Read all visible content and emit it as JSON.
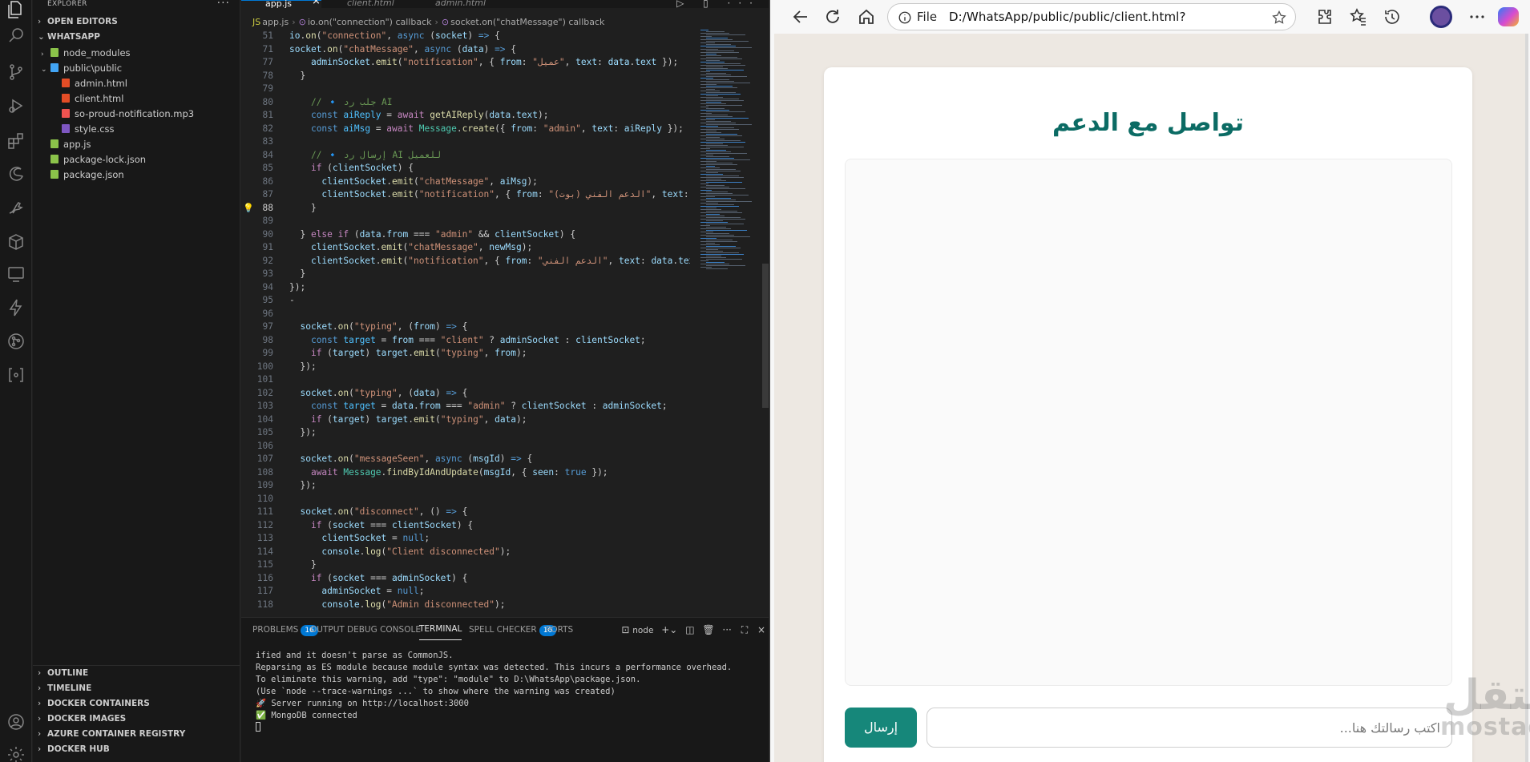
{
  "vscode": {
    "explorer_title": "EXPLORER",
    "open_editors": "OPEN EDITORS",
    "workspace": "WHATSAPP",
    "tree": [
      {
        "label": "node_modules",
        "type": "folder",
        "color": "#8bc34a",
        "depth": 1,
        "chev": "›"
      },
      {
        "label": "public\\public",
        "type": "folder",
        "color": "#42a5f5",
        "depth": 1,
        "chev": "⌄"
      },
      {
        "label": "admin.html",
        "type": "html",
        "color": "#e44d26",
        "depth": 2
      },
      {
        "label": "client.html",
        "type": "html",
        "color": "#e44d26",
        "depth": 2
      },
      {
        "label": "so-proud-notification.mp3",
        "type": "audio",
        "color": "#ef5350",
        "depth": 2
      },
      {
        "label": "style.css",
        "type": "css",
        "color": "#7e57c2",
        "depth": 2
      },
      {
        "label": "app.js",
        "type": "js",
        "color": "#8bc34a",
        "depth": 1
      },
      {
        "label": "package-lock.json",
        "type": "json",
        "color": "#8bc34a",
        "depth": 1
      },
      {
        "label": "package.json",
        "type": "json",
        "color": "#8bc34a",
        "depth": 1
      }
    ],
    "bottom_sections": [
      "OUTLINE",
      "TIMELINE",
      "DOCKER CONTAINERS",
      "DOCKER IMAGES",
      "AZURE CONTAINER REGISTRY",
      "DOCKER HUB"
    ],
    "tabs": [
      {
        "label": "app.js",
        "active": true
      },
      {
        "label": "client.html",
        "active": false
      },
      {
        "label": "admin.html",
        "active": false
      }
    ],
    "breadcrumb": [
      "app.js",
      "io.on(\"connection\") callback",
      "socket.on(\"chatMessage\") callback"
    ],
    "code_lines": [
      {
        "n": "51",
        "html": "<span class='v'>io</span>.<span class='f'>on</span>(<span class='s'>\"connection\"</span>, <span class='k'>async</span> (<span class='v'>socket</span>) <span class='k'>=></span> {"
      },
      {
        "n": "71",
        "html": "<span class='v'>socket</span>.<span class='f'>on</span>(<span class='s'>\"chatMessage\"</span>, <span class='k'>async</span> (<span class='v'>data</span>) <span class='k'>=></span> {"
      },
      {
        "n": "77",
        "html": "    <span class='v'>adminSocket</span>.<span class='f'>emit</span>(<span class='s'>\"notification\"</span>, { <span class='v'>from</span>: <span class='s'>\"عميل\"</span>, <span class='v'>text</span>: <span class='v'>data</span>.<span class='v'>text</span> });"
      },
      {
        "n": "78",
        "html": "  }"
      },
      {
        "n": "79",
        "html": ""
      },
      {
        "n": "80",
        "html": "    <span class='cm'>// 🔹 جلب رد AI</span>"
      },
      {
        "n": "81",
        "html": "    <span class='k'>const</span> <span class='vb'>aiReply</span> = <span class='k2'>await</span> <span class='f'>getAIReply</span>(<span class='v'>data</span>.<span class='v'>text</span>);"
      },
      {
        "n": "82",
        "html": "    <span class='k'>const</span> <span class='vb'>aiMsg</span> = <span class='k2'>await</span> <span class='t'>Message</span>.<span class='f'>create</span>({ <span class='v'>from</span>: <span class='s'>\"admin\"</span>, <span class='v'>text</span>: <span class='v'>aiReply</span> });"
      },
      {
        "n": "83",
        "html": ""
      },
      {
        "n": "84",
        "html": "    <span class='cm'>// 🔹 إرسال رد AI للعميل</span>"
      },
      {
        "n": "85",
        "html": "    <span class='k2'>if</span> (<span class='v'>clientSocket</span>) {"
      },
      {
        "n": "86",
        "html": "      <span class='v'>clientSocket</span>.<span class='f'>emit</span>(<span class='s'>\"chatMessage\"</span>, <span class='v'>aiMsg</span>);"
      },
      {
        "n": "87",
        "html": "      <span class='v'>clientSocket</span>.<span class='f'>emit</span>(<span class='s'>\"notification\"</span>, { <span class='v'>from</span>: <span class='s'>\"الدعم الفني (بوت)\"</span>, <span class='v'>text</span>:"
      },
      {
        "n": "88",
        "html": "    }",
        "current": true
      },
      {
        "n": "89",
        "html": ""
      },
      {
        "n": "90",
        "html": "  } <span class='k2'>else</span> <span class='k2'>if</span> (<span class='v'>data</span>.<span class='v'>from</span> === <span class='s'>\"admin\"</span> &amp;&amp; <span class='v'>clientSocket</span>) {"
      },
      {
        "n": "91",
        "html": "    <span class='v'>clientSocket</span>.<span class='f'>emit</span>(<span class='s'>\"chatMessage\"</span>, <span class='v'>newMsg</span>);"
      },
      {
        "n": "92",
        "html": "    <span class='v'>clientSocket</span>.<span class='f'>emit</span>(<span class='s'>\"notification\"</span>, { <span class='v'>from</span>: <span class='s'>\"الدعم الفني\"</span>, <span class='v'>text</span>: <span class='v'>data</span>.<span class='v'>tex</span>"
      },
      {
        "n": "93",
        "html": "  }"
      },
      {
        "n": "94",
        "html": "});"
      },
      {
        "n": "95",
        "html": "-"
      },
      {
        "n": "96",
        "html": ""
      },
      {
        "n": "97",
        "html": "  <span class='v'>socket</span>.<span class='f'>on</span>(<span class='s'>\"typing\"</span>, (<span class='v'>from</span>) <span class='k'>=></span> {"
      },
      {
        "n": "98",
        "html": "    <span class='k'>const</span> <span class='vb'>target</span> = <span class='v'>from</span> === <span class='s'>\"client\"</span> ? <span class='v'>adminSocket</span> : <span class='v'>clientSocket</span>;"
      },
      {
        "n": "99",
        "html": "    <span class='k2'>if</span> (<span class='v'>target</span>) <span class='v'>target</span>.<span class='f'>emit</span>(<span class='s'>\"typing\"</span>, <span class='v'>from</span>);"
      },
      {
        "n": "100",
        "html": "  });"
      },
      {
        "n": "101",
        "html": ""
      },
      {
        "n": "102",
        "html": "  <span class='v'>socket</span>.<span class='f'>on</span>(<span class='s'>\"typing\"</span>, (<span class='v'>data</span>) <span class='k'>=></span> {"
      },
      {
        "n": "103",
        "html": "    <span class='k'>const</span> <span class='vb'>target</span> = <span class='v'>data</span>.<span class='v'>from</span> === <span class='s'>\"admin\"</span> ? <span class='v'>clientSocket</span> : <span class='v'>adminSocket</span>;"
      },
      {
        "n": "104",
        "html": "    <span class='k2'>if</span> (<span class='v'>target</span>) <span class='v'>target</span>.<span class='f'>emit</span>(<span class='s'>\"typing\"</span>, <span class='v'>data</span>);"
      },
      {
        "n": "105",
        "html": "  });"
      },
      {
        "n": "106",
        "html": ""
      },
      {
        "n": "107",
        "html": "  <span class='v'>socket</span>.<span class='f'>on</span>(<span class='s'>\"messageSeen\"</span>, <span class='k'>async</span> (<span class='v'>msgId</span>) <span class='k'>=></span> {"
      },
      {
        "n": "108",
        "html": "    <span class='k2'>await</span> <span class='t'>Message</span>.<span class='f'>findByIdAndUpdate</span>(<span class='v'>msgId</span>, { <span class='v'>seen</span>: <span class='k'>true</span> });"
      },
      {
        "n": "109",
        "html": "  });"
      },
      {
        "n": "110",
        "html": ""
      },
      {
        "n": "111",
        "html": "  <span class='v'>socket</span>.<span class='f'>on</span>(<span class='s'>\"disconnect\"</span>, () <span class='k'>=></span> {"
      },
      {
        "n": "112",
        "html": "    <span class='k2'>if</span> (<span class='v'>socket</span> === <span class='v'>clientSocket</span>) {"
      },
      {
        "n": "113",
        "html": "      <span class='v'>clientSocket</span> = <span class='k'>null</span>;"
      },
      {
        "n": "114",
        "html": "      <span class='v'>console</span>.<span class='f'>log</span>(<span class='s'>\"Client disconnected\"</span>);"
      },
      {
        "n": "115",
        "html": "    }"
      },
      {
        "n": "116",
        "html": "    <span class='k2'>if</span> (<span class='v'>socket</span> === <span class='v'>adminSocket</span>) {"
      },
      {
        "n": "117",
        "html": "      <span class='v'>adminSocket</span> = <span class='k'>null</span>;"
      },
      {
        "n": "118",
        "html": "      <span class='v'>console</span>.<span class='f'>log</span>(<span class='s'>\"Admin disconnected\"</span>);"
      }
    ],
    "panel_tabs": [
      {
        "label": "PROBLEMS",
        "badge": "16"
      },
      {
        "label": "OUTPUT",
        "badge": ""
      },
      {
        "label": "DEBUG CONSOLE",
        "badge": ""
      },
      {
        "label": "TERMINAL",
        "badge": "",
        "active": true
      },
      {
        "label": "SPELL CHECKER",
        "badge": "16"
      },
      {
        "label": "PORTS",
        "badge": ""
      }
    ],
    "terminal_shell": "node",
    "terminal_lines": [
      "ified and it doesn't parse as CommonJS.",
      "Reparsing as ES module because module syntax was detected. This incurs a performance overhead.",
      "To eliminate this warning, add \"type\": \"module\" to D:\\WhatsApp\\package.json.",
      "(Use `node --trace-warnings ...` to show where the warning was created)",
      "🚀 Server running on http://localhost:3000",
      "✅ MongoDB connected"
    ]
  },
  "browser": {
    "address_label": "File",
    "url": "D:/WhatsApp/public/public/client.html?",
    "chat_title": "تواصل مع الدعم",
    "send_label": "إرسال",
    "input_placeholder": "اكتب رسالتك هنا...",
    "watermark_logo": "مستقل",
    "watermark_text": "mostaql.com",
    "accent_color": "#16877a",
    "title_color": "#0b6b64"
  }
}
